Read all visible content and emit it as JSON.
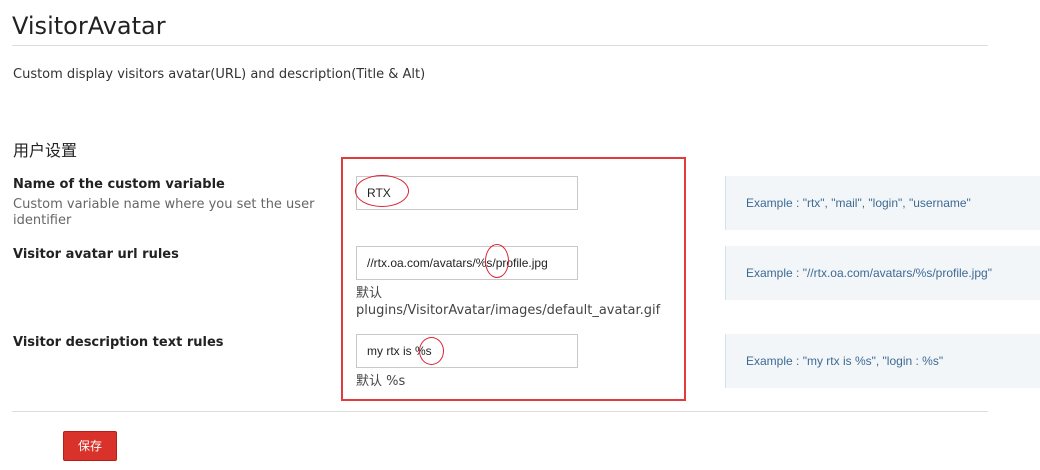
{
  "page": {
    "title": "VisitorAvatar",
    "description": "Custom display visitors avatar(URL) and description(Title & Alt)",
    "section_title": "用户设置"
  },
  "fields": [
    {
      "label": "Name of the custom variable",
      "help": "Custom variable name where you set the user identifier",
      "value": "RTX",
      "hint": "",
      "example": "Example : \"rtx\", \"mail\", \"login\", \"username\""
    },
    {
      "label": "Visitor avatar url rules",
      "help": "",
      "value": "//rtx.oa.com/avatars/%s/profile.jpg",
      "hint_prefix": "默认",
      "hint": "plugins/VisitorAvatar/images/default_avatar.gif",
      "example": "Example : \"//rtx.oa.com/avatars/%s/profile.jpg\""
    },
    {
      "label": "Visitor description text rules",
      "help": "",
      "value": "my rtx is %s",
      "hint": "默认 %s",
      "example": "Example : \"my rtx is %s\", \"login : %s\""
    }
  ],
  "actions": {
    "save_label": "保存"
  },
  "colors": {
    "accent_red": "#d8322a",
    "annotation_red": "#e03c3c",
    "example_text": "#3d6a93"
  }
}
